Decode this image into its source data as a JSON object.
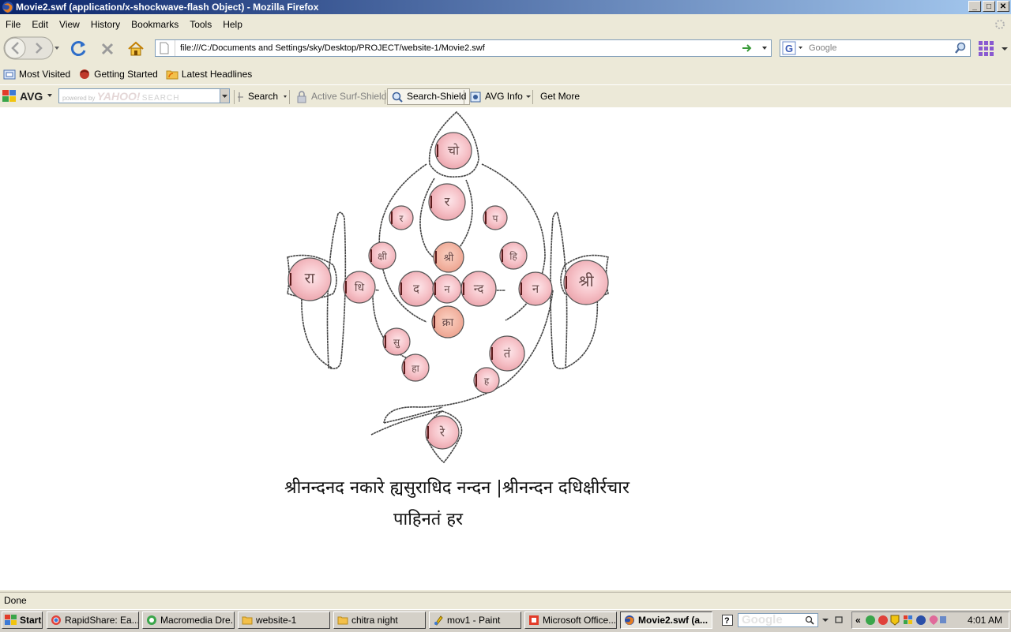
{
  "window": {
    "title": "Movie2.swf (application/x-shockwave-flash Object) - Mozilla Firefox",
    "min_glyph": "_",
    "max_glyph": "□",
    "close_glyph": "✕"
  },
  "menu": [
    "File",
    "Edit",
    "View",
    "History",
    "Bookmarks",
    "Tools",
    "Help"
  ],
  "nav": {
    "url": "file:///C:/Documents and Settings/sky/Desktop/PROJECT/website-1/Movie2.swf",
    "search_placeholder": "Google"
  },
  "bookmarks": [
    "Most Visited",
    "Getting Started",
    "Latest Headlines"
  ],
  "avg": {
    "logo": "AVG",
    "search_powered": "powered by",
    "search_brand": "YAHOO!",
    "search_word": "SEARCH",
    "search_label": "Search",
    "active_surf": "Active Surf-Shield",
    "search_shield": "Search-Shield",
    "avg_info": "AVG Info",
    "get_more": "Get More"
  },
  "flash": {
    "circles": [
      "चो",
      "र",
      "र",
      "प",
      "क्षी",
      "श्री",
      "हि",
      "रा",
      "धि",
      "द",
      "न",
      "न्द",
      "न",
      "श्री",
      "क्रा",
      "सु",
      "तं",
      "हा",
      "ह",
      "रे"
    ],
    "verse_line1": "श्रीनन्दनद नकारे ह्यसुराधिद नन्दन |श्रीनन्दन दधिक्षीर्रचार",
    "verse_line2": "पाहिनतं   हर"
  },
  "status": "Done",
  "taskbar": {
    "start": "Start",
    "tasks": [
      "RapidShare: Ea...",
      "Macromedia Dre...",
      "website-1",
      "chitra night",
      "mov1 - Paint",
      "Microsoft Office...",
      "Movie2.swf (a..."
    ],
    "google_box": "Google",
    "clock": "4:01 AM"
  }
}
